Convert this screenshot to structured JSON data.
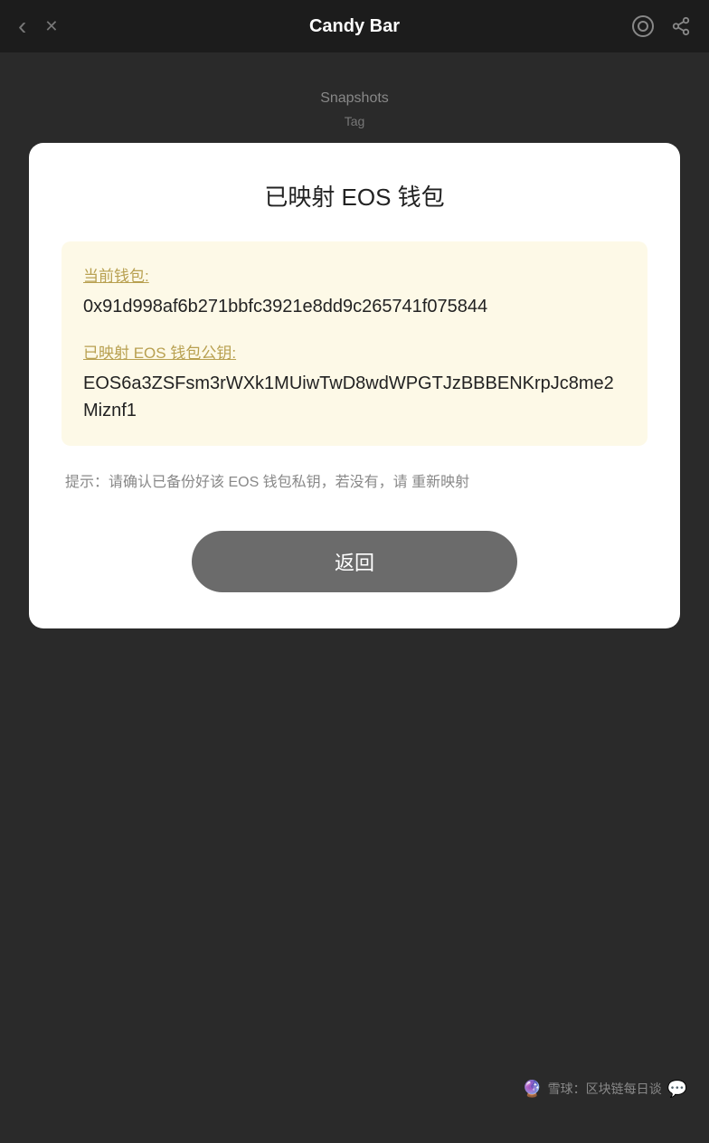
{
  "nav": {
    "title": "Candy Bar",
    "back_label": "‹",
    "close_label": "✕"
  },
  "dark_area": {
    "top_label": "Snapshots",
    "sub_label": "Tag"
  },
  "card": {
    "title": "已映射 EOS 钱包",
    "info_box": {
      "wallet_label": "当前钱包:",
      "wallet_value": "0x91d998af6b271bbfc3921e8dd9c265741f075844",
      "eos_label": "已映射 EOS 钱包公钥:",
      "eos_value": "EOS6a3ZSFsm3rWXk1MUiwTwD8wdWPGTJzBBBENKrpJc8me2Miznf1"
    },
    "hint": "提示：请确认已备份好该 EOS 钱包私钥，若没有，请 重新映射",
    "return_button": "返回"
  },
  "bottom": {
    "watermark": "雪球：区块链每日谈"
  }
}
